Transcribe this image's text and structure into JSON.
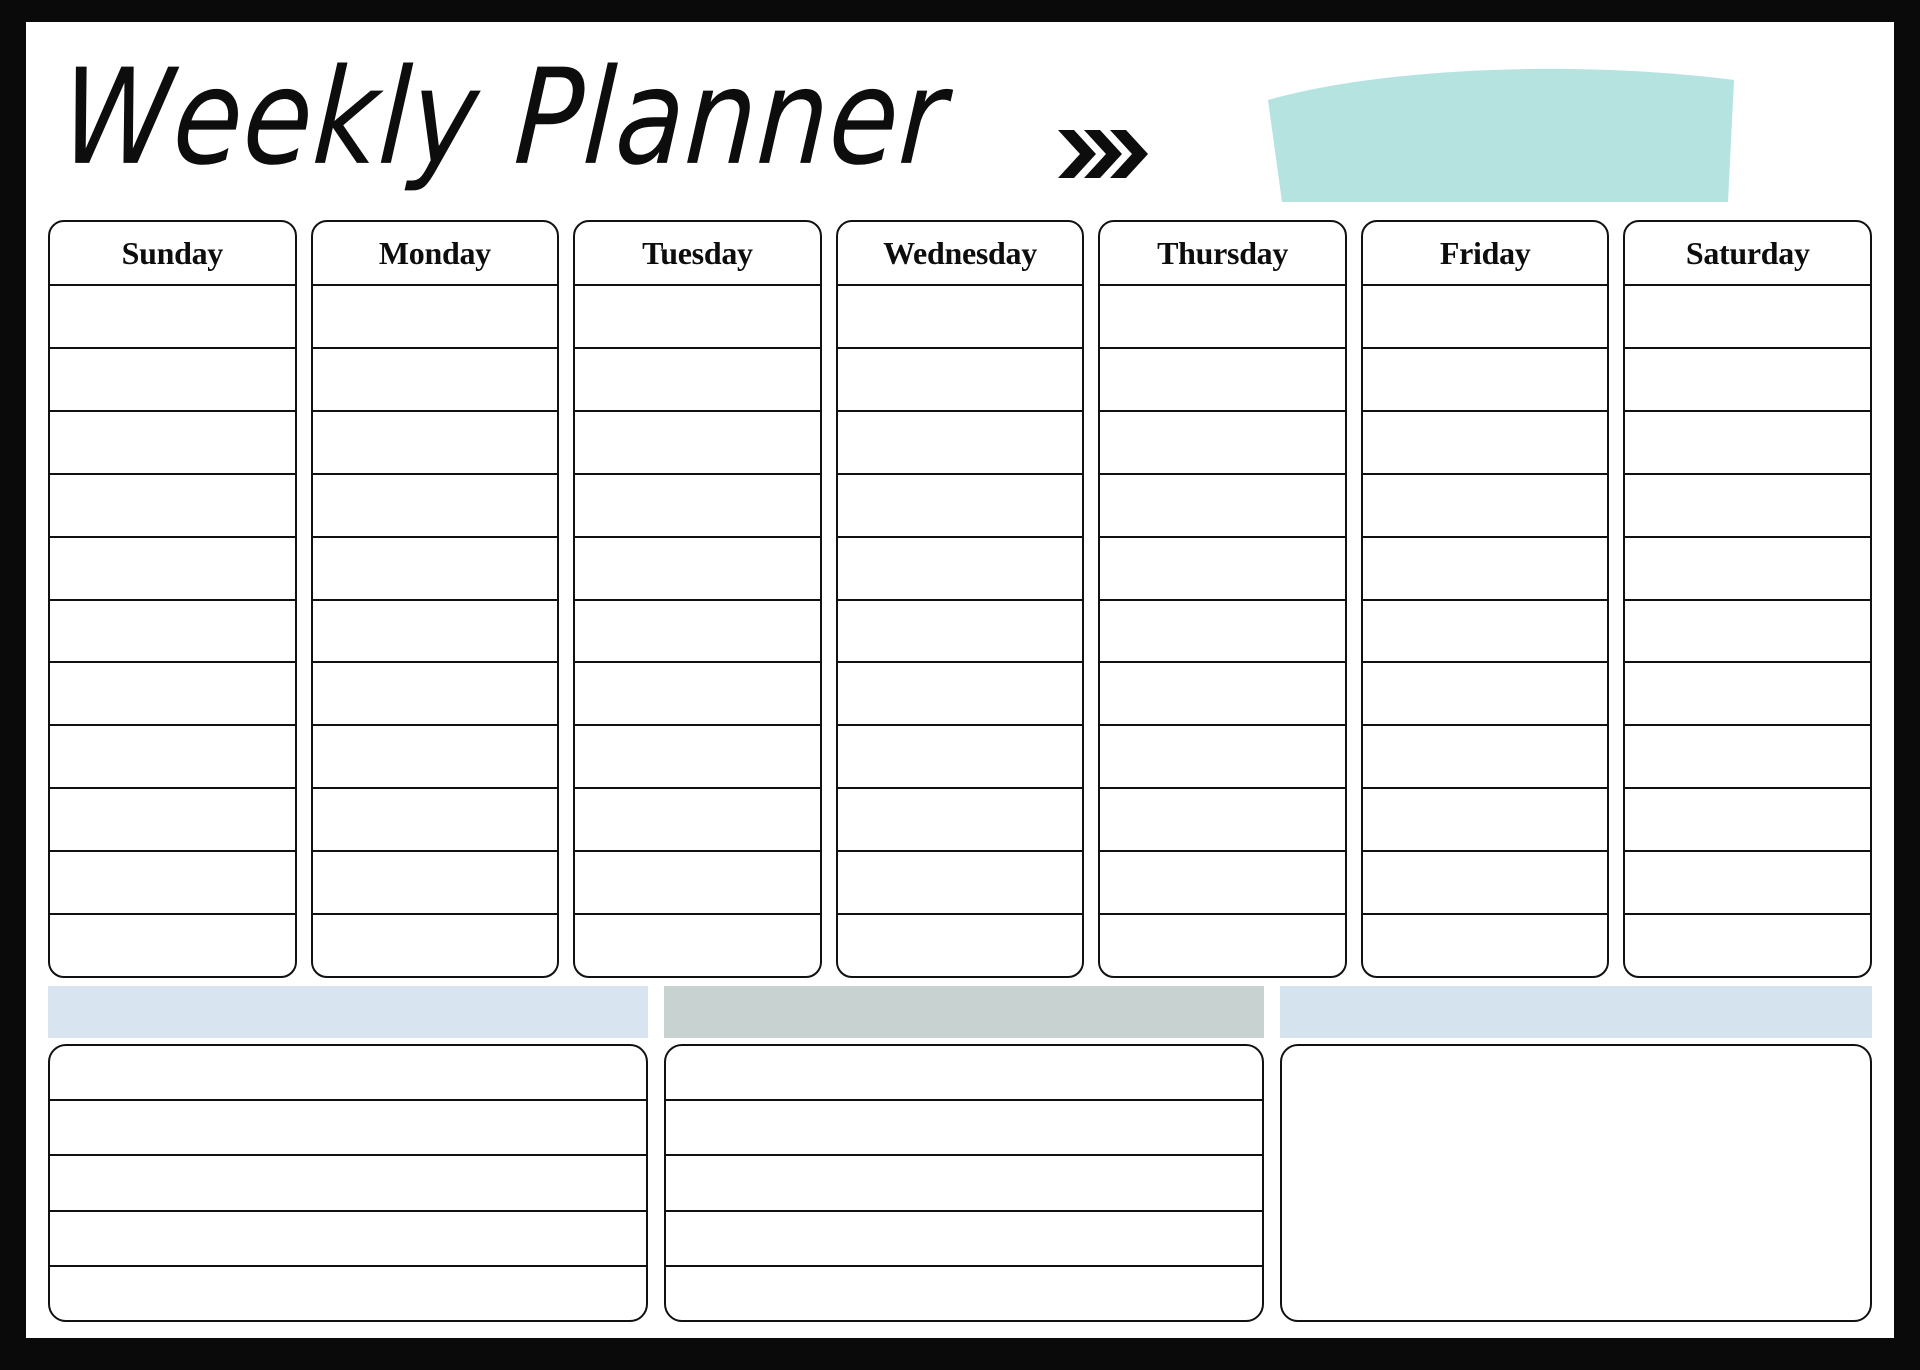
{
  "page": {
    "title": "Weekly Planner",
    "frame_color": "#0a0a0a",
    "paper_color": "#ffffff"
  },
  "header": {
    "title": "Weekly Planner",
    "chevron_icon": "triple-chevron-right-icon",
    "banner_icon": "curved-banner-shape",
    "banner_color": "#b5e3e0",
    "banner_label": ""
  },
  "week": {
    "rows_per_day": 11,
    "days": [
      {
        "label": "Sunday"
      },
      {
        "label": "Monday"
      },
      {
        "label": "Tuesday"
      },
      {
        "label": "Wednesday"
      },
      {
        "label": "Thursday"
      },
      {
        "label": "Friday"
      },
      {
        "label": "Saturday"
      }
    ]
  },
  "bars": [
    {
      "label": "",
      "color": "#d8e4ef"
    },
    {
      "label": "",
      "color": "#c8d2d0"
    },
    {
      "label": "",
      "color": "#d5e3ef"
    }
  ],
  "bottom_boxes": [
    {
      "label": "",
      "rows": 5,
      "blank": false
    },
    {
      "label": "",
      "rows": 5,
      "blank": false
    },
    {
      "label": "",
      "rows": 1,
      "blank": true
    }
  ]
}
